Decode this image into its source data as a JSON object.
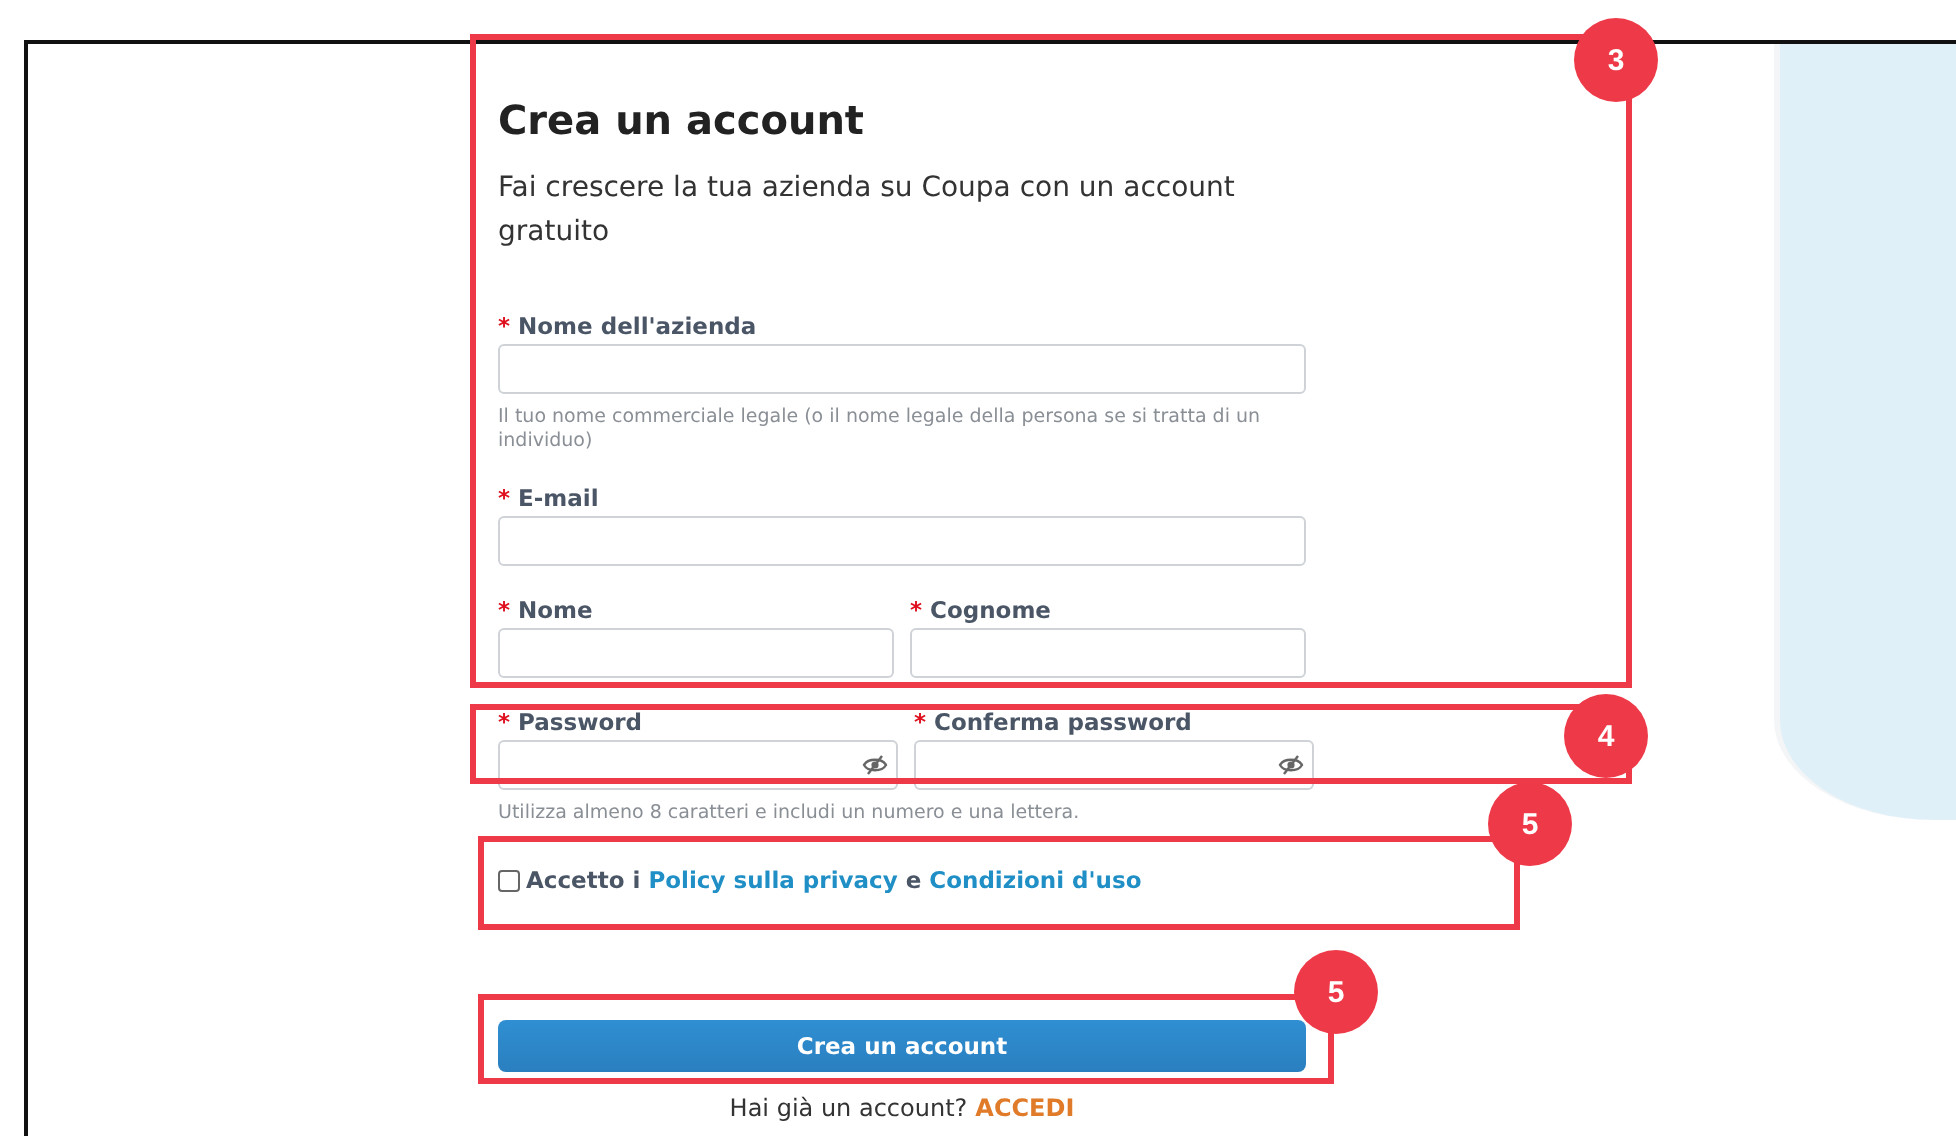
{
  "heading": "Crea un account",
  "subheading": "Fai crescere la tua azienda su Coupa con un account gratuito",
  "rows": [
    {
      "fields": [
        {
          "marker": "*",
          "label": "Nome dell'azienda",
          "kind": "text"
        }
      ],
      "hint": "Il tuo nome commerciale legale (o il nome legale della persona se si tratta di un individuo)"
    },
    {
      "fields": [
        {
          "marker": "*",
          "label": "E-mail",
          "kind": "text"
        }
      ]
    },
    {
      "fields": [
        {
          "marker": "*",
          "label": "Nome",
          "kind": "text"
        },
        {
          "marker": "*",
          "label": "Cognome",
          "kind": "text"
        }
      ]
    },
    {
      "fields": [
        {
          "marker": "*",
          "label": "Password",
          "kind": "password"
        },
        {
          "marker": "*",
          "label": "Conferma password",
          "kind": "password"
        }
      ],
      "hint": "Utilizza almeno 8 caratteri e includi un numero e una lettera."
    }
  ],
  "consent": {
    "checked": false,
    "prefix": "Accetto i",
    "link_1": "Policy sulla privacy",
    "middle": "e",
    "link_2": "Condizioni d'uso"
  },
  "submit_button": "Crea un account",
  "login_prompt": {
    "text": "Hai già un account?",
    "link": "ACCEDI"
  },
  "callouts": [
    {
      "label": "3"
    },
    {
      "label": "4"
    },
    {
      "label": "5"
    },
    {
      "label": "5"
    }
  ]
}
